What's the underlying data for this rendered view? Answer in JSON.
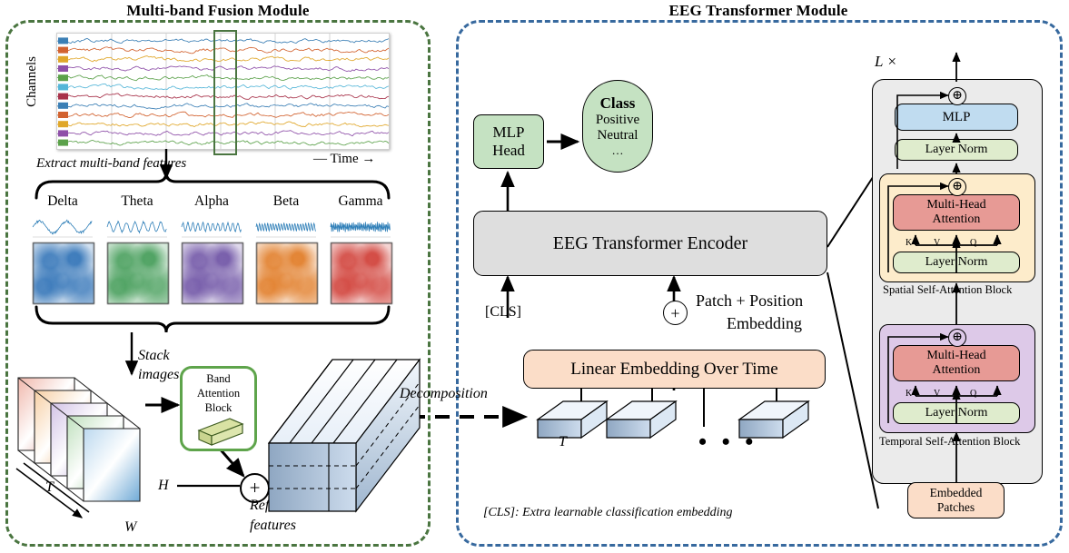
{
  "titles": {
    "left": "Multi-band Fusion Module",
    "right": "EEG Transformer Module"
  },
  "colors": {
    "left_border": "#4a7540",
    "right_border": "#37699e",
    "green_fill": "#c5e2c2",
    "grey_fill": "#dedede",
    "peach_fill": "#fbddc8",
    "blue_fill": "#c0dcf0",
    "layernorm_fill": "#dfeccd",
    "attention_fill": "#e79a95",
    "spatial_fill": "#fdeccb",
    "temporal_fill": "#ddc9e8",
    "panel_fill": "#ebebeb",
    "band_block_border": "#5ea44b",
    "band_block_fill": "#d4de9a"
  },
  "left": {
    "channels_label": "Channels",
    "time_label": "— Time →",
    "extract_label": "Extract multi-band features",
    "bands": [
      {
        "name": "Delta",
        "color": "#2b6fb5"
      },
      {
        "name": "Theta",
        "color": "#3f9a54"
      },
      {
        "name": "Alpha",
        "color": "#6b4fa3"
      },
      {
        "name": "Beta",
        "color": "#e07820"
      },
      {
        "name": "Gamma",
        "color": "#cf3a32"
      }
    ],
    "stack_label_line1": "Stack",
    "stack_label_line2": "images",
    "band_attention": [
      "Band",
      "Attention",
      "Block"
    ],
    "axis_T": "T",
    "axis_W": "W",
    "axis_H": "H",
    "plus_symbol": "+",
    "refined_line1": "Refined",
    "refined_line2": "features",
    "decomposition_label": "Decomposition"
  },
  "right": {
    "mlp_head_line1": "MLP",
    "mlp_head_line2": "Head",
    "class_title": "Class",
    "class_items": [
      "Positive",
      "Neutral",
      "…"
    ],
    "encoder_label": "EEG Transformer Encoder",
    "cls_token": "[CLS]",
    "plus_symbol": "+",
    "patch_pos_line1": "Patch + Position",
    "patch_pos_line2": "Embedding",
    "linear_embedding": "Linear Embedding Over Time",
    "patch_T_label": "T",
    "ellipsis": "• • •",
    "footnote": "[CLS]: Extra learnable classification embedding"
  },
  "detail": {
    "repeat_label": "L ×",
    "mlp": "MLP",
    "layer_norm": "Layer Norm",
    "multi_head_line1": "Multi-Head",
    "multi_head_line2": "Attention",
    "kvq": [
      "K",
      "V",
      "Q"
    ],
    "spatial_block": "Spatial Self-Attention Block",
    "temporal_block": "Temporal Self-Attention Block",
    "embedded_line1": "Embedded",
    "embedded_line2": "Patches",
    "plus_symbol": "⊕"
  }
}
